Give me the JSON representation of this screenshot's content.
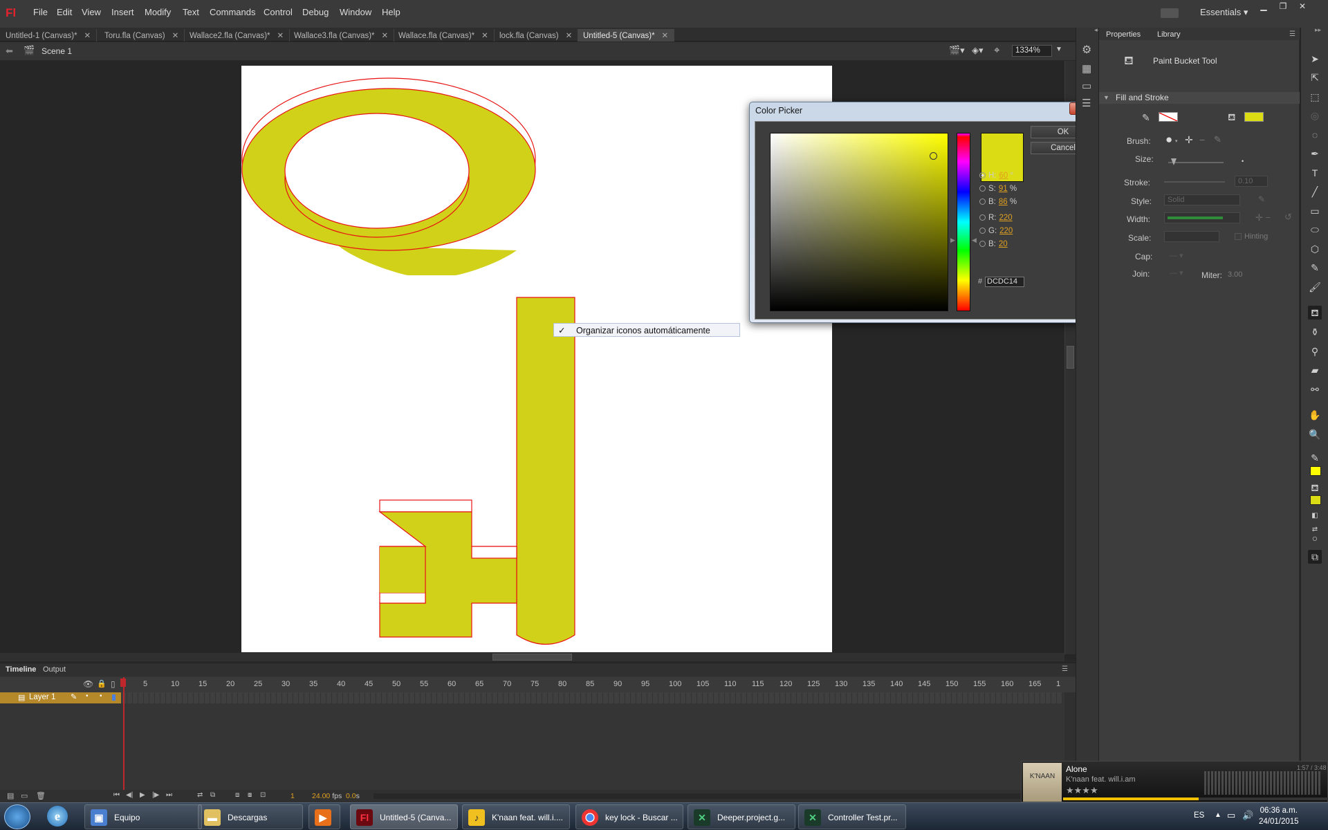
{
  "app": {
    "logo": "Fl",
    "workspace": "Essentials"
  },
  "menu": [
    "File",
    "Edit",
    "View",
    "Insert",
    "Modify",
    "Text",
    "Commands",
    "Control",
    "Debug",
    "Window",
    "Help"
  ],
  "doc_tabs": [
    {
      "label": "Untitled-1 (Canvas)*",
      "active": false
    },
    {
      "label": "Toru.fla (Canvas)",
      "active": false
    },
    {
      "label": "Wallace2.fla (Canvas)*",
      "active": false
    },
    {
      "label": "Wallace3.fla (Canvas)*",
      "active": false
    },
    {
      "label": "Wallace.fla (Canvas)*",
      "active": false
    },
    {
      "label": "lock.fla (Canvas)",
      "active": false
    },
    {
      "label": "Untitled-5 (Canvas)*",
      "active": true
    }
  ],
  "editbar": {
    "scene": "Scene 1",
    "zoom": "1334%"
  },
  "context_menu": {
    "check": "✓",
    "item": "Organizar iconos automáticamente"
  },
  "color_picker": {
    "title": "Color Picker",
    "ok": "OK",
    "cancel": "Cancel",
    "swatch_color": "#DCDC14",
    "h_label": "H:",
    "h_value": "60",
    "h_unit": "°",
    "s_label": "S:",
    "s_value": "91",
    "s_unit": "%",
    "b_label": "B:",
    "b_value": "86",
    "b_unit": "%",
    "r_label": "R:",
    "r_value": "220",
    "g_label": "G:",
    "g_value": "220",
    "bb_label": "B:",
    "bb_value": "20",
    "hex_hash": "#",
    "hex": "DCDC14",
    "selected_mode": "H"
  },
  "properties": {
    "tab_properties": "Properties",
    "tab_library": "Library",
    "tool_name": "Paint Bucket Tool",
    "section": "Fill and Stroke",
    "fill_color": "#dcdc14",
    "brush_label": "Brush:",
    "size_label": "Size:",
    "stroke_label": "Stroke:",
    "stroke_value": "0.10",
    "style_label": "Style:",
    "style_value": "Solid",
    "width_label": "Width:",
    "scale_label": "Scale:",
    "hinting_label": "Hinting",
    "cap_label": "Cap:",
    "join_label": "Join:",
    "miter_label": "Miter:",
    "miter_value": "3.00"
  },
  "timeline": {
    "tab_timeline": "Timeline",
    "tab_output": "Output",
    "layer": "Layer 1",
    "ticks": [
      "1",
      "5",
      "10",
      "15",
      "20",
      "25",
      "30",
      "35",
      "40",
      "45",
      "50",
      "55",
      "60",
      "65",
      "70",
      "75",
      "80",
      "85",
      "90",
      "95",
      "100",
      "105",
      "110",
      "115",
      "120",
      "125",
      "130",
      "135",
      "140",
      "145",
      "150",
      "155",
      "160",
      "165",
      "1"
    ],
    "current_frame": "1",
    "fps": "24.00",
    "fps_unit": "fps",
    "time": "0.0",
    "time_unit": "s"
  },
  "taskbar": {
    "buttons": [
      {
        "label": "Equipo",
        "icon": "computer-icon"
      },
      {
        "label": "Descargas",
        "icon": "folder-icon"
      },
      {
        "label": "",
        "icon": "media-player-icon"
      },
      {
        "label": "Untitled-5 (Canva...",
        "icon": "flash-icon"
      },
      {
        "label": "K'naan feat. will.i....",
        "icon": "music-player-icon"
      },
      {
        "label": "key lock - Buscar ...",
        "icon": "chrome-icon"
      },
      {
        "label": "Deeper.project.g...",
        "icon": "app-icon"
      },
      {
        "label": "Controller Test.pr...",
        "icon": "app-icon"
      }
    ],
    "lang": "ES",
    "time": "06:36 a.m.",
    "date": "24/01/2015"
  },
  "media": {
    "album_art_text": "K'NAAN",
    "title": "Alone",
    "artist": "K'naan feat. will.i.am",
    "stars": "★★★★",
    "time": "1:57 / 3:48",
    "progress": 0.51
  }
}
